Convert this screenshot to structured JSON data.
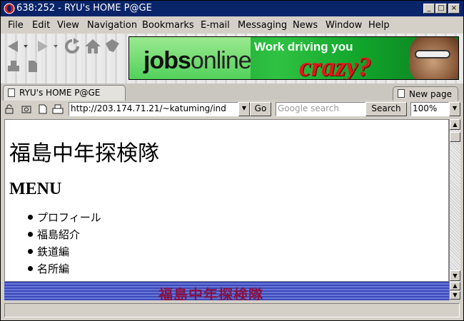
{
  "window": {
    "title": "638:252 - RYU's HOME P@GE",
    "minimize": "_",
    "maximize": "□",
    "close": "×"
  },
  "menubar": [
    "File",
    "Edit",
    "View",
    "Navigation",
    "Bookmarks",
    "E-mail",
    "Messaging",
    "News",
    "Window",
    "Help"
  ],
  "toolbar": {
    "icons": [
      "back-icon",
      "forward-icon",
      "reload-icon",
      "home-icon",
      "bookmarks-icon",
      "print-icon",
      "document-icon"
    ]
  },
  "banner": {
    "brand_bold": "jobs",
    "brand_light": "online",
    "tagline_top": "Work driving you",
    "tagline_big": "crazy?"
  },
  "tabs": {
    "active": "RYU's HOME P@GE",
    "new_page": "New page"
  },
  "address": {
    "url": "http://203.174.71.21/~katuming/ind",
    "go_label": "Go",
    "search_placeholder": "Google search",
    "search_button": "Search",
    "zoom": "100%"
  },
  "content": {
    "page_title": "福島中年探検隊",
    "menu_heading": "MENU",
    "menu_items": [
      "プロフィール",
      "福島紹介",
      "鉄道編",
      "名所編"
    ]
  },
  "bottom_frame": {
    "title": "福島中年探検隊"
  },
  "status": {
    "text": ""
  }
}
